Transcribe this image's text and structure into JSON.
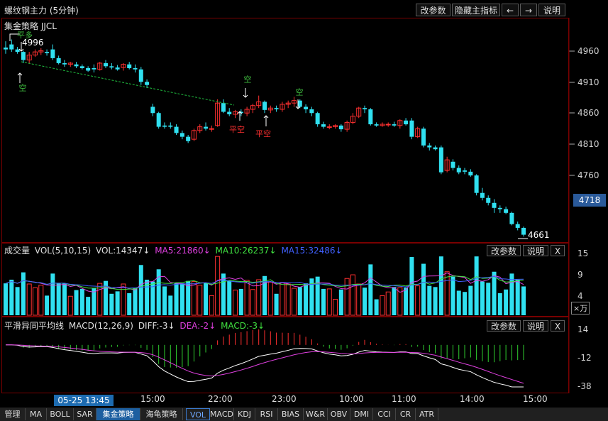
{
  "window": {
    "title": "螺纹钢主力 (5分钟)",
    "buttons": [
      "改参数",
      "隐藏主指标",
      "←",
      "→",
      "说明"
    ]
  },
  "main_panel": {
    "strategy_label": "集金策略 JJCL",
    "y_ticks": [
      "4960",
      "4910",
      "4860",
      "4810",
      "4760"
    ],
    "current_price": "4718",
    "high_label": "4996",
    "low_label": "4661",
    "signals": [
      {
        "text": "平多",
        "color": "#40c040"
      },
      {
        "text": "空",
        "color": "#40c040"
      },
      {
        "text": "空",
        "color": "#40c040"
      },
      {
        "text": "平空",
        "color": "#ff3030"
      },
      {
        "text": "平空",
        "color": "#ff3030"
      },
      {
        "text": "空",
        "color": "#40c040"
      }
    ]
  },
  "volume_panel": {
    "label": "成交量",
    "indicator": "VOL(5,10,15)",
    "vol": "VOL:14347↓",
    "ma5": "MA5:21860↓",
    "ma10": "MA10:26237↓",
    "ma15": "MA15:32486↓",
    "buttons": [
      "改参数",
      "说明",
      "X"
    ],
    "y_ticks": [
      "15",
      "9",
      "4"
    ],
    "unit": "×万",
    "colors": {
      "ma5": "#e040e0",
      "ma10": "#40e040",
      "ma15": "#4060ff"
    }
  },
  "macd_panel": {
    "label": "平滑异同平均线",
    "indicator": "MACD(12,26,9)",
    "diff": "DIFF:-3↓",
    "dea": "DEA:-2↓",
    "macd": "MACD:-3↓",
    "buttons": [
      "改参数",
      "说明",
      "X"
    ],
    "y_ticks": [
      "14",
      "-12",
      "-38"
    ]
  },
  "x_axis": {
    "cursor_date": "05-25 13:45",
    "ticks": [
      "15:00",
      "22:00",
      "23:00",
      "10:00",
      "11:00",
      "14:00",
      "15:00"
    ]
  },
  "bottom_tabs": [
    "管理",
    "MA",
    "BOLL",
    "SAR",
    "集金策略",
    "海龟策略",
    "VOL",
    "MACD",
    "KDJ",
    "RSI",
    "BIAS",
    "W&R",
    "OBV",
    "DMI",
    "CCI",
    "CR",
    "ATR"
  ],
  "chart_data": {
    "type": "candlestick",
    "price_candles_ohlc": [
      [
        4965,
        4975,
        4955,
        4962
      ],
      [
        4970,
        4978,
        4958,
        4962
      ],
      [
        4962,
        4966,
        4955,
        4958
      ],
      [
        4958,
        4960,
        4940,
        4945
      ],
      [
        4945,
        4958,
        4940,
        4953
      ],
      [
        4953,
        4962,
        4950,
        4958
      ],
      [
        4958,
        4964,
        4953,
        4960
      ],
      [
        4958,
        4962,
        4952,
        4956
      ],
      [
        4962,
        4970,
        4945,
        4948
      ],
      [
        4948,
        4952,
        4938,
        4940
      ],
      [
        4940,
        4945,
        4934,
        4938
      ],
      [
        4938,
        4942,
        4934,
        4940
      ],
      [
        4938,
        4942,
        4932,
        4935
      ],
      [
        4935,
        4938,
        4930,
        4932
      ],
      [
        4932,
        4935,
        4926,
        4928
      ],
      [
        4932,
        4938,
        4925,
        4930
      ],
      [
        4930,
        4942,
        4928,
        4940
      ],
      [
        4940,
        4945,
        4932,
        4935
      ],
      [
        4935,
        4940,
        4930,
        4933
      ],
      [
        4933,
        4937,
        4928,
        4930
      ],
      [
        4933,
        4940,
        4928,
        4938
      ],
      [
        4938,
        4942,
        4930,
        4932
      ],
      [
        4932,
        4938,
        4925,
        4930
      ],
      [
        4930,
        4934,
        4905,
        4910
      ],
      [
        4910,
        4914,
        4900,
        4905
      ],
      [
        4870,
        4875,
        4855,
        4860
      ],
      [
        4860,
        4862,
        4835,
        4838
      ],
      [
        4840,
        4845,
        4835,
        4838
      ],
      [
        4840,
        4845,
        4835,
        4838
      ],
      [
        4838,
        4842,
        4825,
        4828
      ],
      [
        4828,
        4832,
        4818,
        4822
      ],
      [
        4822,
        4825,
        4812,
        4815
      ],
      [
        4818,
        4835,
        4815,
        4832
      ],
      [
        4832,
        4842,
        4828,
        4838
      ],
      [
        4838,
        4845,
        4832,
        4835
      ],
      [
        4835,
        4840,
        4830,
        4835
      ],
      [
        4840,
        4882,
        4838,
        4876
      ],
      [
        4876,
        4882,
        4860,
        4862
      ],
      [
        4862,
        4868,
        4855,
        4858
      ],
      [
        4858,
        4865,
        4852,
        4862
      ],
      [
        4862,
        4866,
        4855,
        4860
      ],
      [
        4860,
        4870,
        4855,
        4866
      ],
      [
        4866,
        4875,
        4860,
        4872
      ],
      [
        4872,
        4888,
        4868,
        4878
      ],
      [
        4878,
        4880,
        4860,
        4865
      ],
      [
        4865,
        4872,
        4860,
        4868
      ],
      [
        4868,
        4872,
        4862,
        4866
      ],
      [
        4866,
        4878,
        4862,
        4874
      ],
      [
        4874,
        4880,
        4868,
        4876
      ],
      [
        4876,
        4886,
        4870,
        4880
      ],
      [
        4880,
        4882,
        4868,
        4870
      ],
      [
        4870,
        4874,
        4860,
        4866
      ],
      [
        4866,
        4870,
        4855,
        4860
      ],
      [
        4860,
        4862,
        4838,
        4842
      ],
      [
        4842,
        4846,
        4835,
        4838
      ],
      [
        4838,
        4842,
        4834,
        4838
      ],
      [
        4838,
        4842,
        4835,
        4840
      ],
      [
        4840,
        4842,
        4830,
        4834
      ],
      [
        4834,
        4848,
        4830,
        4845
      ],
      [
        4845,
        4860,
        4842,
        4855
      ],
      [
        4855,
        4870,
        4852,
        4868
      ],
      [
        4868,
        4872,
        4860,
        4866
      ],
      [
        4866,
        4868,
        4840,
        4842
      ],
      [
        4842,
        4845,
        4838,
        4840
      ],
      [
        4840,
        4845,
        4838,
        4842
      ],
      [
        4842,
        4845,
        4838,
        4842
      ],
      [
        4842,
        4846,
        4838,
        4840
      ],
      [
        4840,
        4850,
        4835,
        4848
      ],
      [
        4848,
        4852,
        4840,
        4842
      ],
      [
        4848,
        4852,
        4818,
        4822
      ],
      [
        4822,
        4838,
        4820,
        4835
      ],
      [
        4835,
        4838,
        4805,
        4808
      ],
      [
        4808,
        4812,
        4800,
        4805
      ],
      [
        4805,
        4808,
        4800,
        4802
      ],
      [
        4805,
        4808,
        4762,
        4765
      ],
      [
        4768,
        4790,
        4765,
        4785
      ],
      [
        4782,
        4786,
        4768,
        4772
      ],
      [
        4772,
        4776,
        4762,
        4765
      ],
      [
        4768,
        4772,
        4762,
        4766
      ],
      [
        4766,
        4770,
        4758,
        4760
      ],
      [
        4760,
        4762,
        4728,
        4732
      ],
      [
        4732,
        4740,
        4720,
        4724
      ],
      [
        4724,
        4728,
        4712,
        4716
      ],
      [
        4716,
        4722,
        4700,
        4708
      ],
      [
        4708,
        4712,
        4700,
        4706
      ],
      [
        4706,
        4710,
        4698,
        4700
      ],
      [
        4700,
        4702,
        4680,
        4682
      ],
      [
        4682,
        4686,
        4672,
        4676
      ],
      [
        4676,
        4678,
        4662,
        4665
      ]
    ],
    "volume_unit": "万",
    "macd_range": [
      -38,
      14
    ]
  }
}
